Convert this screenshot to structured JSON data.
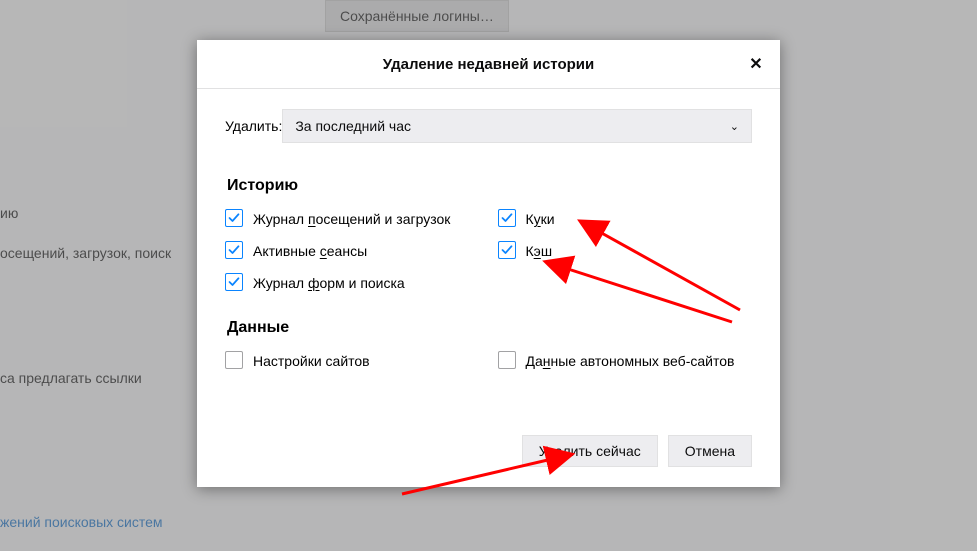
{
  "background": {
    "saved_logins_button": "Сохранённые логины…",
    "text1_frag": "ию",
    "text2_frag": "осещений, загрузок, поиск",
    "text3_frag": "са предлагать ссылки",
    "link_frag": "жений поисковых систем"
  },
  "dialog": {
    "title": "Удаление недавней истории",
    "close_icon_text": "✕",
    "time": {
      "label": "Удалить:",
      "selected": "За последний час",
      "chevron": "⌄"
    },
    "section_history": "Историю",
    "section_data": "Данные",
    "opts": {
      "browsing": {
        "checked": true,
        "label_pre": "Журнал ",
        "u": "п",
        "label_post": "осещений и загрузок"
      },
      "cookies": {
        "checked": true,
        "label_pre": "К",
        "u": "у",
        "label_post": "ки"
      },
      "sessions": {
        "checked": true,
        "label_pre": "Активные ",
        "u": "с",
        "label_post": "еансы"
      },
      "cache": {
        "checked": true,
        "label_pre": "К",
        "u": "э",
        "label_post": "ш"
      },
      "forms": {
        "checked": true,
        "label_pre": "Журнал ",
        "u": "ф",
        "label_post": "орм и поиска"
      },
      "site_prefs": {
        "checked": false,
        "label_pre": "Настройки сайтов",
        "u": "",
        "label_post": ""
      },
      "offline": {
        "checked": false,
        "label_pre": "Да",
        "u": "н",
        "label_post": "ные автономных веб-сайтов"
      }
    },
    "buttons": {
      "clear": "Удалить сейчас",
      "cancel": "Отмена"
    }
  },
  "colors": {
    "accent": "#0a84ff",
    "link": "#0a6bc9"
  }
}
